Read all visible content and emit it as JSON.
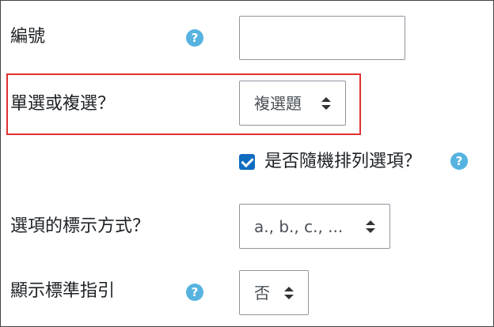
{
  "form": {
    "number": {
      "label": "編號",
      "help_icon": "?",
      "value": ""
    },
    "single_multi": {
      "label": "單選或複選？",
      "selected": "複選題"
    },
    "shuffle": {
      "checked": true,
      "label": "是否隨機排列選項？",
      "help_icon": "?"
    },
    "numbering": {
      "label": "選項的標示方式？",
      "selected": "a., b., c., ..."
    },
    "show_instructions": {
      "label": "顯示標準指引",
      "help_icon": "?",
      "selected": "否"
    }
  },
  "colors": {
    "highlight": "#e03131",
    "help_icon": "#56b3e0",
    "checkbox": "#0f6cbf",
    "border": "#8f959e"
  }
}
